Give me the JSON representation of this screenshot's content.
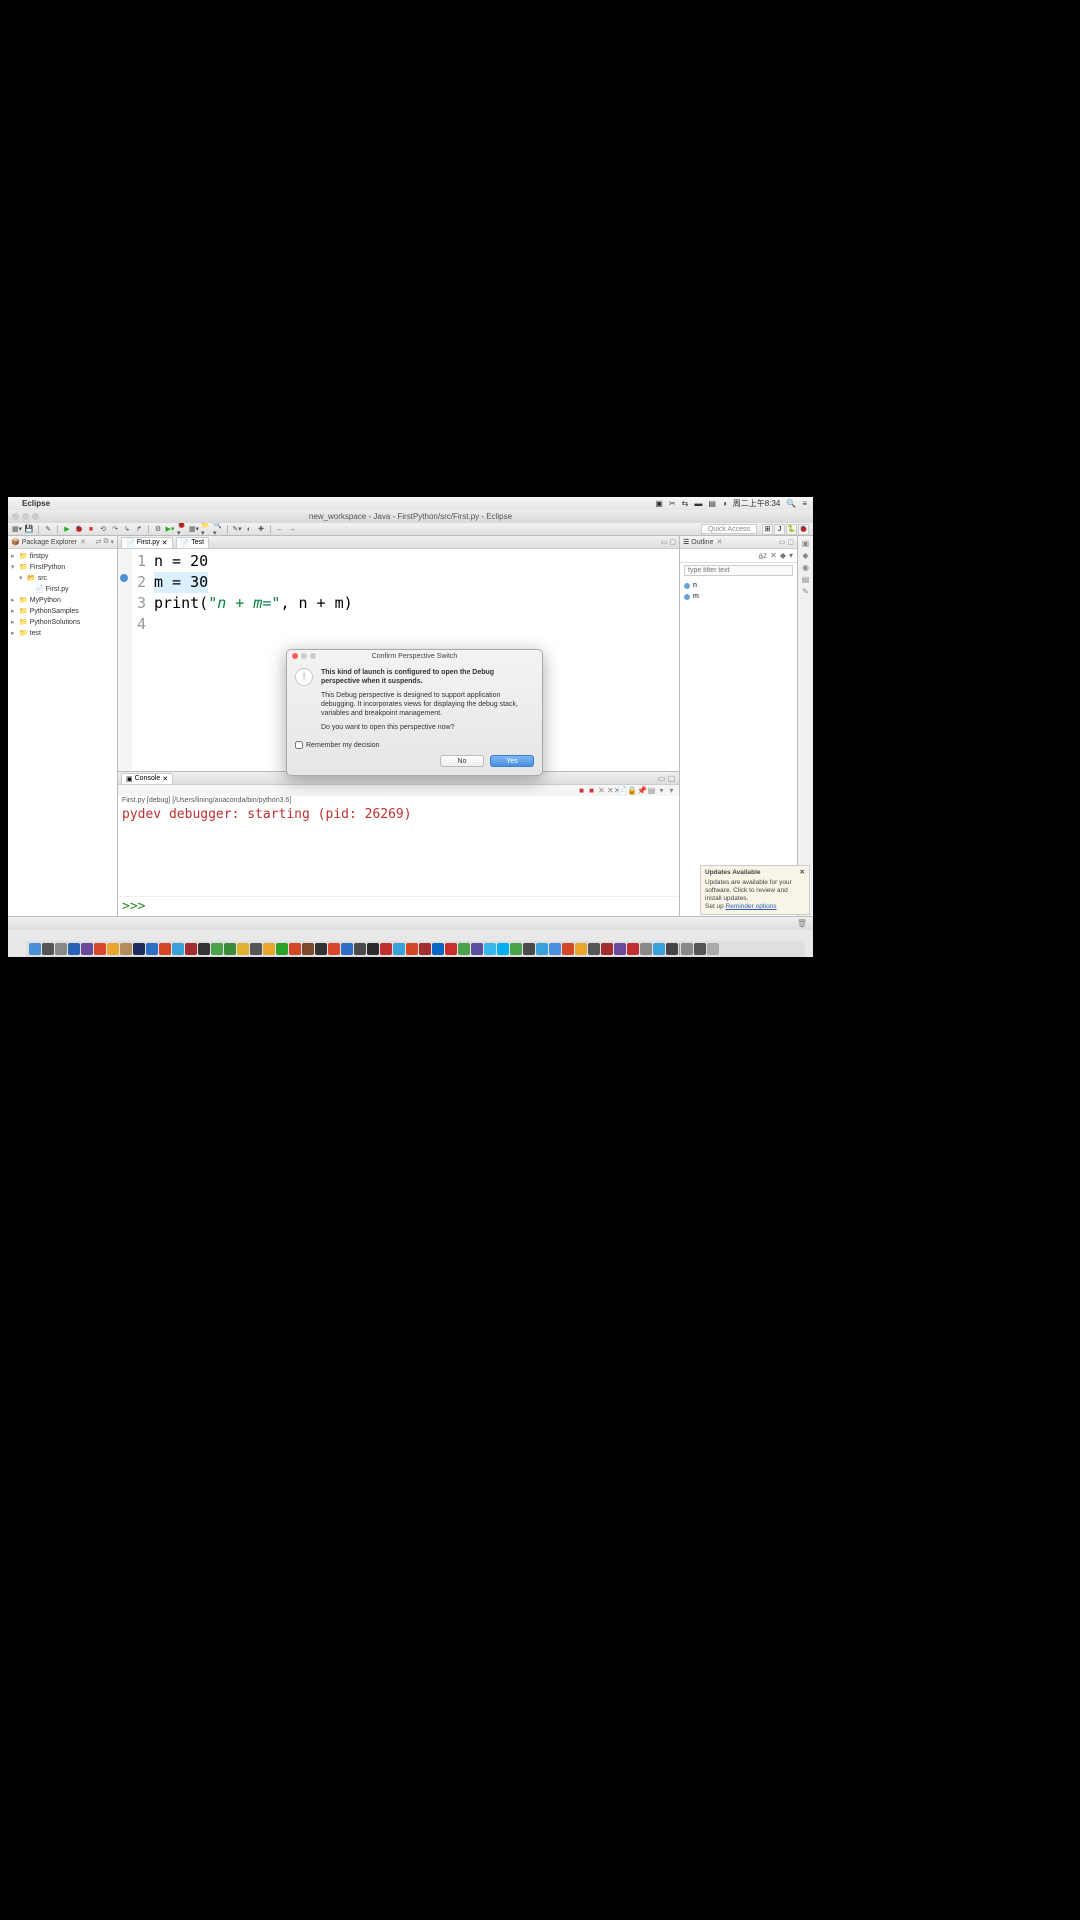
{
  "menubar": {
    "app": "Eclipse",
    "clock": "周二上午8:34"
  },
  "window_title": "new_workspace - Java - FirstPython/src/First.py - Eclipse",
  "quick_access": "Quick Access",
  "panels": {
    "package_explorer": "Package Explorer",
    "outline": "Outline",
    "console": "Console"
  },
  "tree": {
    "items": [
      {
        "label": "firstpy",
        "level": 0,
        "arrow": "▸"
      },
      {
        "label": "FirstPython",
        "level": 0,
        "arrow": "▾"
      },
      {
        "label": "src",
        "level": 1,
        "arrow": "▾"
      },
      {
        "label": "First.py",
        "level": 2,
        "arrow": ""
      },
      {
        "label": "MyPython",
        "level": 0,
        "arrow": "▸"
      },
      {
        "label": "PythonSamples",
        "level": 0,
        "arrow": "▸"
      },
      {
        "label": "PythonSolutions",
        "level": 0,
        "arrow": "▸"
      },
      {
        "label": "test",
        "level": 0,
        "arrow": "▸"
      }
    ]
  },
  "editor": {
    "tabs": [
      {
        "label": "First.py"
      },
      {
        "label": "Test"
      }
    ],
    "lines": {
      "l1a": "n = ",
      "l1b": "20",
      "l2a": "m = 30",
      "l3a": "print(",
      "l3b": "\"n + m=\"",
      "l3c": ", n + m)"
    }
  },
  "outline": {
    "filter_placeholder": "type filter text",
    "items": [
      {
        "name": "n"
      },
      {
        "name": "m"
      }
    ]
  },
  "console": {
    "info": "First.py [debug] [/Users/lining/anaconda/bin/python3.6]",
    "output": "pydev debugger: starting (pid: 26269)",
    "prompt": ">>> "
  },
  "dialog": {
    "title": "Confirm Perspective Switch",
    "p1": "This kind of launch is configured to open the Debug perspective when it suspends.",
    "p2": "This Debug perspective is designed to support application debugging. It incorporates views for displaying the debug stack, variables and breakpoint management.",
    "p3": "Do you want to open this perspective now?",
    "remember": "Remember my decision",
    "no": "No",
    "yes": "Yes"
  },
  "updates": {
    "title": "Updates Available",
    "body": "Updates are available for your software. Click to review and install updates.",
    "setup": "Set up ",
    "link": "Reminder options"
  }
}
